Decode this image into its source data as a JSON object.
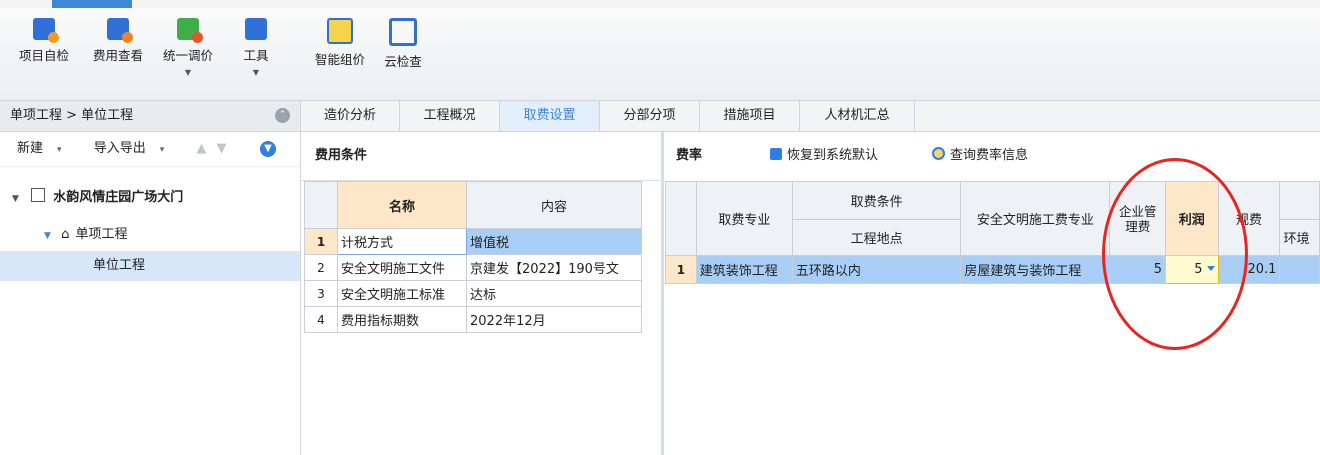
{
  "ribbon": {
    "buttons": [
      {
        "label": "项目自检",
        "icon": "check-icon"
      },
      {
        "label": "费用查看",
        "icon": "fee-view-icon"
      },
      {
        "label": "统一调价",
        "icon": "price-adjust-icon",
        "dropdown": true
      },
      {
        "label": "工具",
        "icon": "tools-icon",
        "dropdown": true
      },
      {
        "label": "智能组价",
        "icon": "smart-price-icon"
      },
      {
        "label": "云检查",
        "icon": "cloud-check-icon"
      }
    ]
  },
  "left_panel": {
    "breadcrumb": "单项工程 > 单位工程",
    "new_label": "新建",
    "import_export_label": "导入导出",
    "tree": {
      "project": "水韵风情庄园广场大门",
      "single": "单项工程",
      "unit": "单位工程"
    }
  },
  "tabs": [
    "造价分析",
    "工程概况",
    "取费设置",
    "分部分项",
    "措施项目",
    "人材机汇总"
  ],
  "active_tab": "取费设置",
  "fee_conditions": {
    "title": "费用条件",
    "headers": {
      "name": "名称",
      "content": "内容"
    },
    "rows": [
      {
        "no": "1",
        "name": "计税方式",
        "content": "增值税"
      },
      {
        "no": "2",
        "name": "安全文明施工文件",
        "content": "京建发【2022】190号文"
      },
      {
        "no": "3",
        "name": "安全文明施工标准",
        "content": "达标"
      },
      {
        "no": "4",
        "name": "费用指标期数",
        "content": "2022年12月"
      }
    ]
  },
  "rates": {
    "title": "费率",
    "restore_label": "恢复到系统默认",
    "query_label": "查询费率信息",
    "headers": {
      "specialty": "取费专业",
      "condition": "取费条件",
      "location": "工程地点",
      "safety": "安全文明施工费专业",
      "mgmt": "企业管理费",
      "profit": "利润",
      "fee": "规费",
      "env": "环境"
    },
    "row": {
      "no": "1",
      "specialty": "建筑装饰工程",
      "location": "五环路以内",
      "safety": "房屋建筑与装饰工程",
      "mgmt": "5",
      "profit": "5",
      "fee": "20.1"
    }
  },
  "colors": {
    "accent": "#3c87d8",
    "selection": "#a8cef6",
    "highlight_header": "#fde7c8",
    "annotation": "#e6261f"
  }
}
